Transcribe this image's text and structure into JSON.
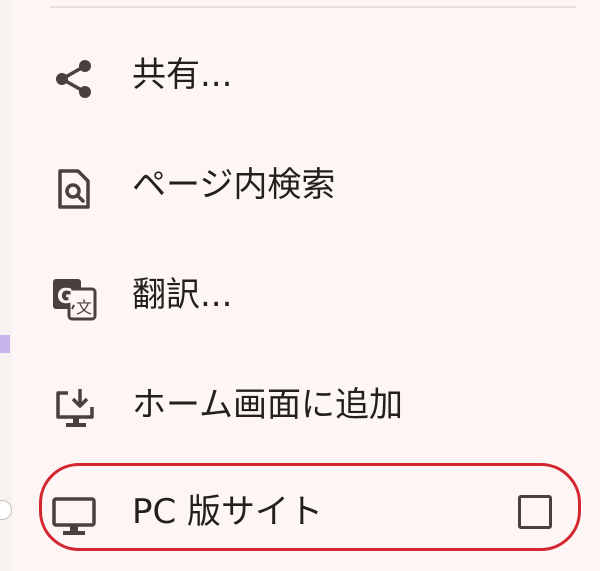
{
  "menu": {
    "items": [
      {
        "id": "share",
        "label": "共有...",
        "icon": "share-icon"
      },
      {
        "id": "find-in-page",
        "label": "ページ内検索",
        "icon": "find-in-page-icon"
      },
      {
        "id": "translate",
        "label": "翻訳...",
        "icon": "translate-icon"
      },
      {
        "id": "add-to-home",
        "label": "ホーム画面に追加",
        "icon": "add-to-home-screen-icon"
      },
      {
        "id": "desktop-site",
        "label": "PC 版サイト",
        "icon": "desktop-icon",
        "checked": false
      }
    ]
  },
  "colors": {
    "background": "#fdf6f4",
    "text": "#231f1e",
    "icon": "#4a403e",
    "highlight": "#d4262f"
  }
}
